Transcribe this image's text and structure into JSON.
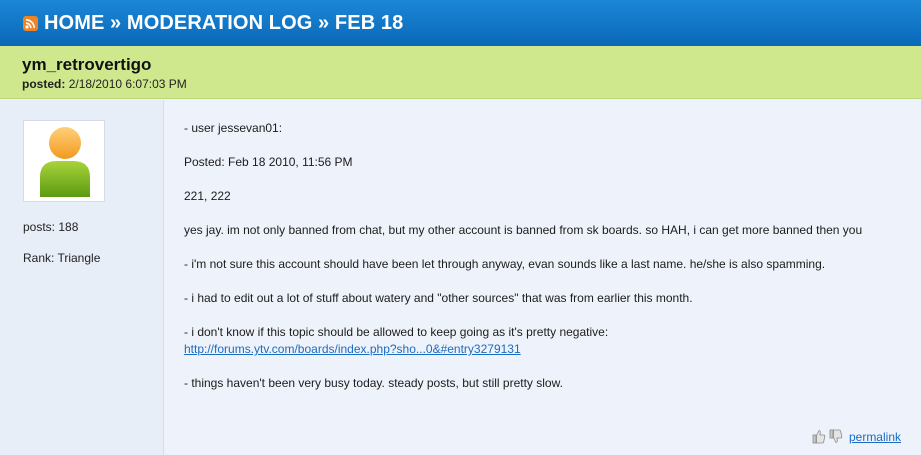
{
  "header": {
    "icon": "rss-icon",
    "breadcrumb": "HOME » MODERATION LOG » FEB 18"
  },
  "post": {
    "author": "ym_retrovertigo",
    "posted_label": "posted:",
    "posted_value": "2/18/2010 6:07:03 PM"
  },
  "sidebar": {
    "avatar_icon": "user-avatar-icon",
    "posts": "posts: 188",
    "rank": "Rank: Triangle"
  },
  "body": {
    "p1": "- user jessevan01:",
    "p2": "Posted: Feb 18 2010, 11:56 PM",
    "p3": "221, 222",
    "p4": "yes jay. im not only banned from chat, but my other account is banned from sk boards. so HAH, i can get more banned then you",
    "p5": "- i'm not sure this account should have been let through anyway, evan sounds like a last name. he/she is also spamming.",
    "p6": "- i had to edit out a lot of stuff about watery and \"other sources\" that was from earlier this month.",
    "p7": "- i don't know if this topic should be allowed to keep going as it's pretty negative:",
    "p7_link": "http://forums.ytv.com/boards/index.php?sho...0&#entry3279131",
    "p8": "- things haven't been very busy today. steady posts, but still pretty slow."
  },
  "footer": {
    "thumbs_up_icon": "thumbs-up-icon",
    "thumbs_down_icon": "thumbs-down-icon",
    "permalink": "permalink"
  },
  "colors": {
    "header_bg": "#0f76c6",
    "post_head_bg": "#cfe88e",
    "page_bg": "#eef2fa",
    "link": "#1a6cc4"
  }
}
